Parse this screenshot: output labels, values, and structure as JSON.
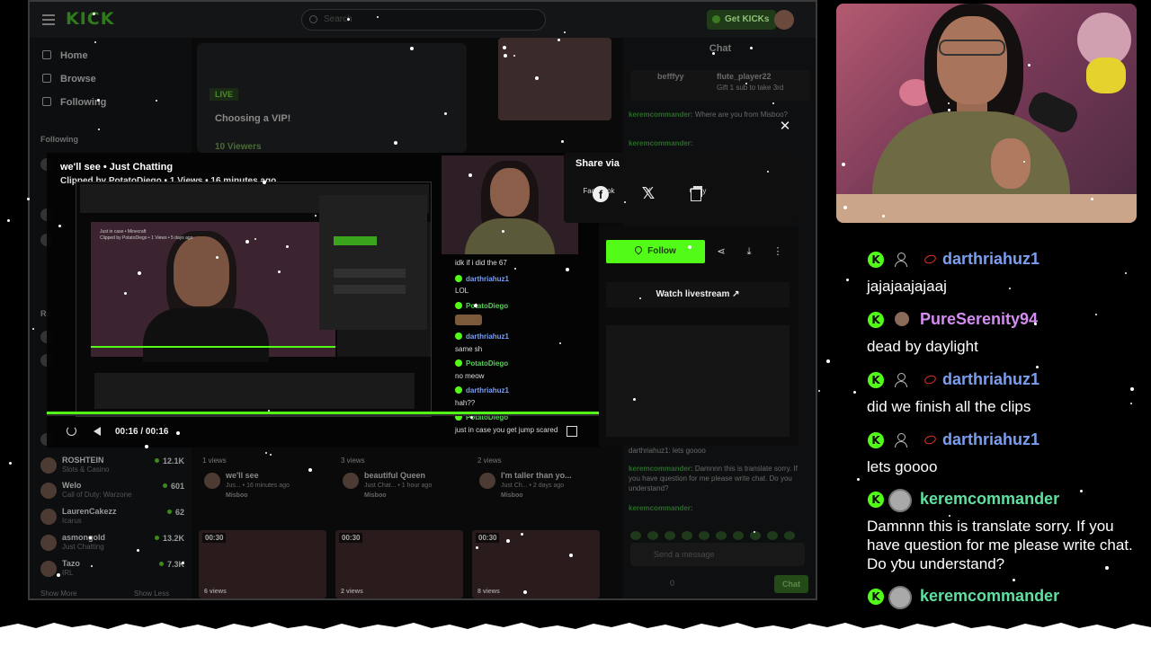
{
  "topbar": {
    "logo": "KICK",
    "search_placeholder": "Search",
    "get_kicks": "Get KICKs"
  },
  "sidebar": {
    "nav": [
      "Home",
      "Browse",
      "Following"
    ],
    "following_header": "Following",
    "rec_header": "Re",
    "channels": [
      {
        "name": "ROSHTEIN",
        "category": "Slots & Casino",
        "viewers": "12.1K"
      },
      {
        "name": "Welo",
        "category": "Call of Duty: Warzone",
        "viewers": "601"
      },
      {
        "name": "LaurenCakezz",
        "category": "Icarus",
        "viewers": "62"
      },
      {
        "name": "asmongold",
        "category": "Just Chatting",
        "viewers": "13.2K"
      },
      {
        "name": "Tazo",
        "category": "IRL",
        "viewers": "7.3K"
      }
    ],
    "show_more": "Show More",
    "show_less": "Show Less"
  },
  "content": {
    "live_badge": "LIVE",
    "live_title": "Choosing a VIP!",
    "live_viewers": "10 Viewers",
    "video_cards": [
      {
        "views": "1 views",
        "title": "we'll see",
        "meta": "Jus... • 16 minutes ago",
        "channel": "Misboo"
      },
      {
        "views": "3 views",
        "title": "beautiful Queen",
        "meta": "Just Chat... • 1 hour ago",
        "channel": "Misboo"
      },
      {
        "views": "2 views",
        "title": "I'm taller than yo...",
        "meta": "Just Ch... • 2 days ago",
        "channel": "Misboo"
      }
    ],
    "grid_thumbs": [
      {
        "duration": "00:30",
        "views": "6 views"
      },
      {
        "duration": "00:30",
        "views": "2 views"
      },
      {
        "duration": "00:30",
        "views": "8 views"
      }
    ]
  },
  "chat_panel": {
    "header": "Chat",
    "gift_user_1": "befffyy",
    "gift_user_2": "flute_player22",
    "gift_text": "Gift 1 sub to take 3rd",
    "message_1_user": "keremcommander:",
    "message_1_text": "Where are you from Misboo?",
    "message_2_user": "keremcommander:",
    "message_3_text": "darthriahuz1: lets goooo",
    "message_4_user": "keremcommander:",
    "message_4_text": "Damnnn this is translate sorry. If you have question for me please write chat. Do you understand?",
    "message_5_user": "keremcommander:",
    "input_placeholder": "Send a message",
    "points": "0",
    "chat_button": "Chat"
  },
  "clip": {
    "title": "we'll see • Just Chatting",
    "meta": "Clipped by PotatoDiego • 1 Views • 16 minutes ago",
    "nested_title": "Just in case • Minecraft",
    "nested_meta": "Clipped by PotatoDiego • 1 Views • 5 days ago",
    "timecode": "00:16 / 00:16",
    "chat": [
      {
        "user": "",
        "text": "idk if i did the 67"
      },
      {
        "user": "darthriahuz1",
        "text": "LOL",
        "blue": true
      },
      {
        "user": "PotatoDiego",
        "text": "",
        "blue": false
      },
      {
        "user": "darthriahuz1",
        "text": "same sh",
        "blue": true
      },
      {
        "user": "PotatoDiego",
        "text": "no meow",
        "blue": false
      },
      {
        "user": "darthriahuz1",
        "text": "hah??",
        "blue": true
      },
      {
        "user": "PotatoDiego",
        "text": "just in case you get jump scared",
        "blue": false
      }
    ]
  },
  "share": {
    "title": "Share via",
    "options": [
      "Facebook",
      "X",
      "Copy"
    ]
  },
  "actions": {
    "follow": "Follow",
    "watch_livestream": "Watch livestream"
  },
  "stream_chat": [
    {
      "user": "darthriahuz1",
      "color": "#7b9ef0",
      "badge": "person",
      "text": "jajajaajajaaj"
    },
    {
      "user": "PureSerenity94",
      "color": "#d48cf0",
      "badge": "bear",
      "text": "dead by daylight"
    },
    {
      "user": "darthriahuz1",
      "color": "#7b9ef0",
      "badge": "person",
      "text": "did we finish all the clips"
    },
    {
      "user": "darthriahuz1",
      "color": "#7b9ef0",
      "badge": "person",
      "text": "lets goooo"
    },
    {
      "user": "keremcommander",
      "color": "#5fe0a0",
      "badge": "avatar",
      "text": "Damnnn this is translate sorry. If you have question for me please write chat. Do you understand?"
    },
    {
      "user": "keremcommander",
      "color": "#5fe0a0",
      "badge": "avatar",
      "text": ""
    }
  ],
  "colors": {
    "kick_green": "#53fc18",
    "username_blue": "#7b9ef0",
    "username_purple": "#d48cf0",
    "username_teal": "#5fe0a0"
  }
}
